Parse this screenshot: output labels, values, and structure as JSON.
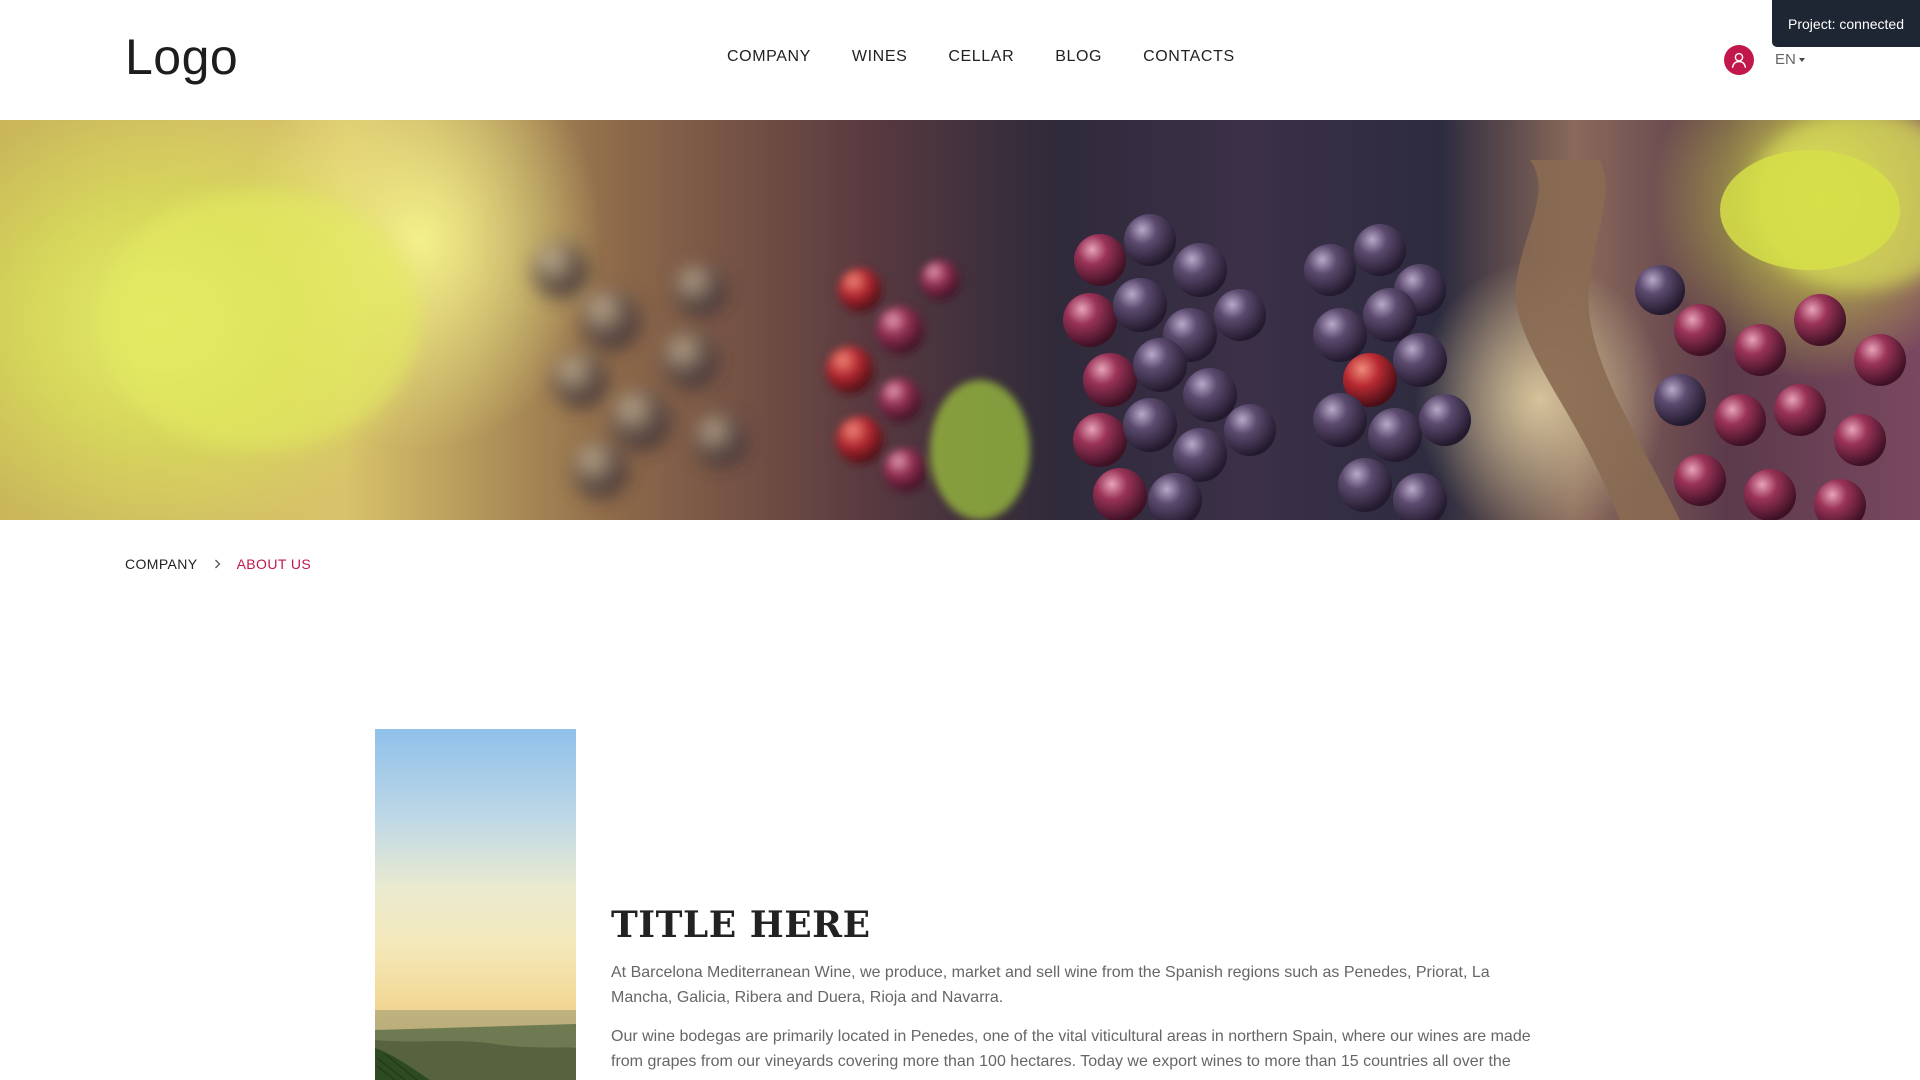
{
  "header": {
    "logo": "Logo",
    "nav": [
      "COMPANY",
      "WINES",
      "CELLAR",
      "BLOG",
      "CONTACTS"
    ],
    "language": "EN"
  },
  "status_badge": "Project: connected",
  "breadcrumb": {
    "parent": "COMPANY",
    "current": "ABOUT US"
  },
  "content": {
    "title": "TITLE HERE",
    "paragraphs": [
      "At Barcelona Mediterranean Wine, we produce, market and sell wine from the Spanish regions such as Penedes, Priorat, La Mancha, Galicia, Ribera and Duera, Rioja and Navarra.",
      "Our wine bodegas are primarily located in Penedes, one of the vital viticultural areas in northern Spain, where our wines are made from grapes from our vineyards covering more than 100 hectares. Today we export wines to more than 15 countries all over the"
    ]
  },
  "colors": {
    "accent": "#c2174b",
    "badge_bg": "#1f2633",
    "text_dark": "#222222",
    "text_muted": "#666666"
  },
  "icons": {
    "user": "user-icon",
    "language_caret": "caret-down-icon",
    "breadcrumb_separator": "chevron-right-icon"
  }
}
